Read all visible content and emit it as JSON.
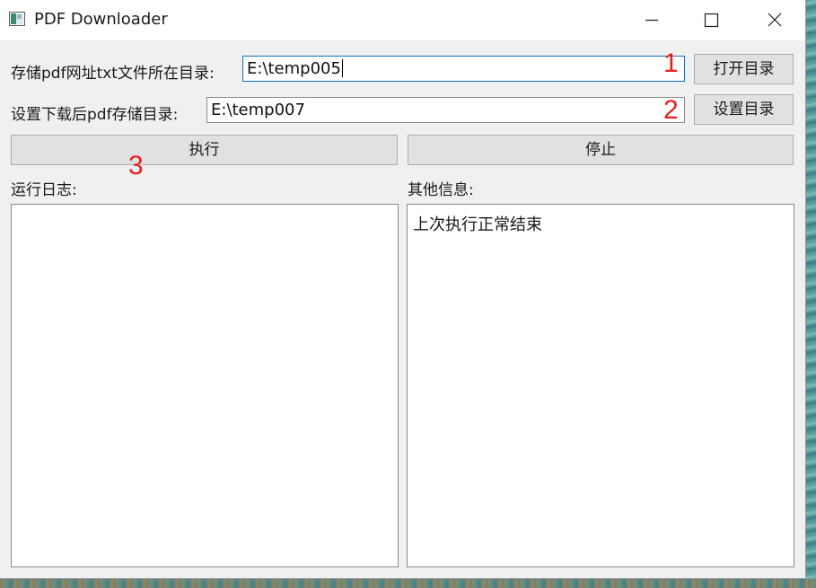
{
  "window": {
    "title": "PDF Downloader",
    "controls": {
      "minimize": "minimize",
      "maximize": "maximize",
      "close": "close"
    }
  },
  "form": {
    "source_dir_label": "存储pdf网址txt文件所在目录:",
    "source_dir_value": "E:\\temp005",
    "open_dir_button": "打开目录",
    "output_dir_label": "设置下载后pdf存储目录:",
    "output_dir_value": "E:\\temp007",
    "set_dir_button": "设置目录"
  },
  "actions": {
    "run_button": "执行",
    "stop_button": "停止"
  },
  "log": {
    "label": "运行日志:",
    "content": ""
  },
  "info": {
    "label": "其他信息:",
    "content": "上次执行正常结束"
  },
  "annotations": {
    "marker_1": "1",
    "marker_2": "2",
    "marker_3": "3",
    "color": "#e8201a"
  },
  "icons": [
    "app-icon",
    "minimize-icon",
    "maximize-icon",
    "close-icon"
  ]
}
